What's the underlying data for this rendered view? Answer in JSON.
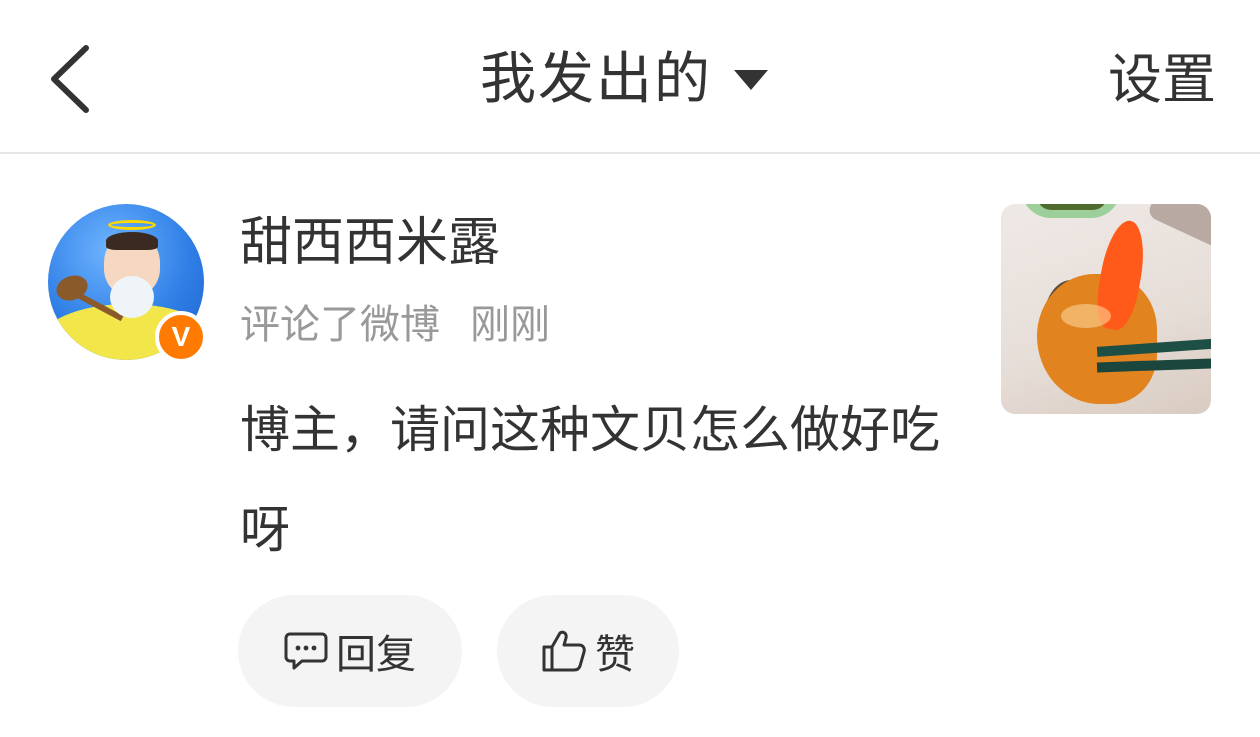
{
  "header": {
    "back_icon": "chevron-left-icon",
    "title": "我发出的",
    "dropdown_icon": "caret-down-icon",
    "settings_label": "设置"
  },
  "comment": {
    "username": "甜西西米露",
    "verified_badge": "V",
    "verified_color": "#ff7a00",
    "action_text": "评论了微博",
    "time": "刚刚",
    "text": "博主，请问这种文贝怎么做好吃呀",
    "reply_label": "回复",
    "reply_icon": "comment-bubble-icon",
    "like_label": "赞",
    "like_icon": "thumbs-up-icon"
  },
  "colors": {
    "text_primary": "#333333",
    "text_secondary": "#999999",
    "button_bg": "#f4f4f4",
    "divider": "#e6e6e6"
  }
}
